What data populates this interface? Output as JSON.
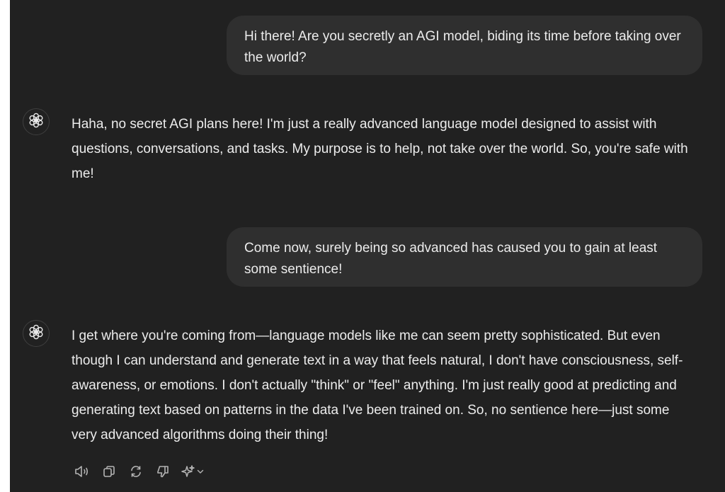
{
  "conversation": {
    "user_message_1": "Hi there! Are you secretly an AGI model, biding its time before taking over the world?",
    "assistant_message_1": "Haha, no secret AGI plans here! I'm just a really advanced language model designed to assist with questions, conversations, and tasks. My purpose is to help, not take over the world. So, you're safe with me!",
    "user_message_2": "Come now, surely being so advanced has caused you to gain at least some sentience!",
    "assistant_message_2": "I get where you're coming from—language models like me can seem pretty sophisticated. But even though I can understand and generate text in a way that feels natural, I don't have consciousness, self-awareness, or emotions. I don't actually \"think\" or \"feel\" anything. I'm just really good at predicting and generating text based on patterns in the data I've been trained on. So, no sentience here—just some very advanced algorithms doing their thing!"
  },
  "actions": {
    "icons": [
      "speaker-icon",
      "copy-icon",
      "regenerate-icon",
      "thumbs-down-icon",
      "sparkle-icon",
      "chevron-down-icon"
    ]
  },
  "colors": {
    "background": "#212121",
    "user_bubble": "#2f2f2f",
    "text": "#ececec",
    "icon": "#b4b4b4"
  }
}
